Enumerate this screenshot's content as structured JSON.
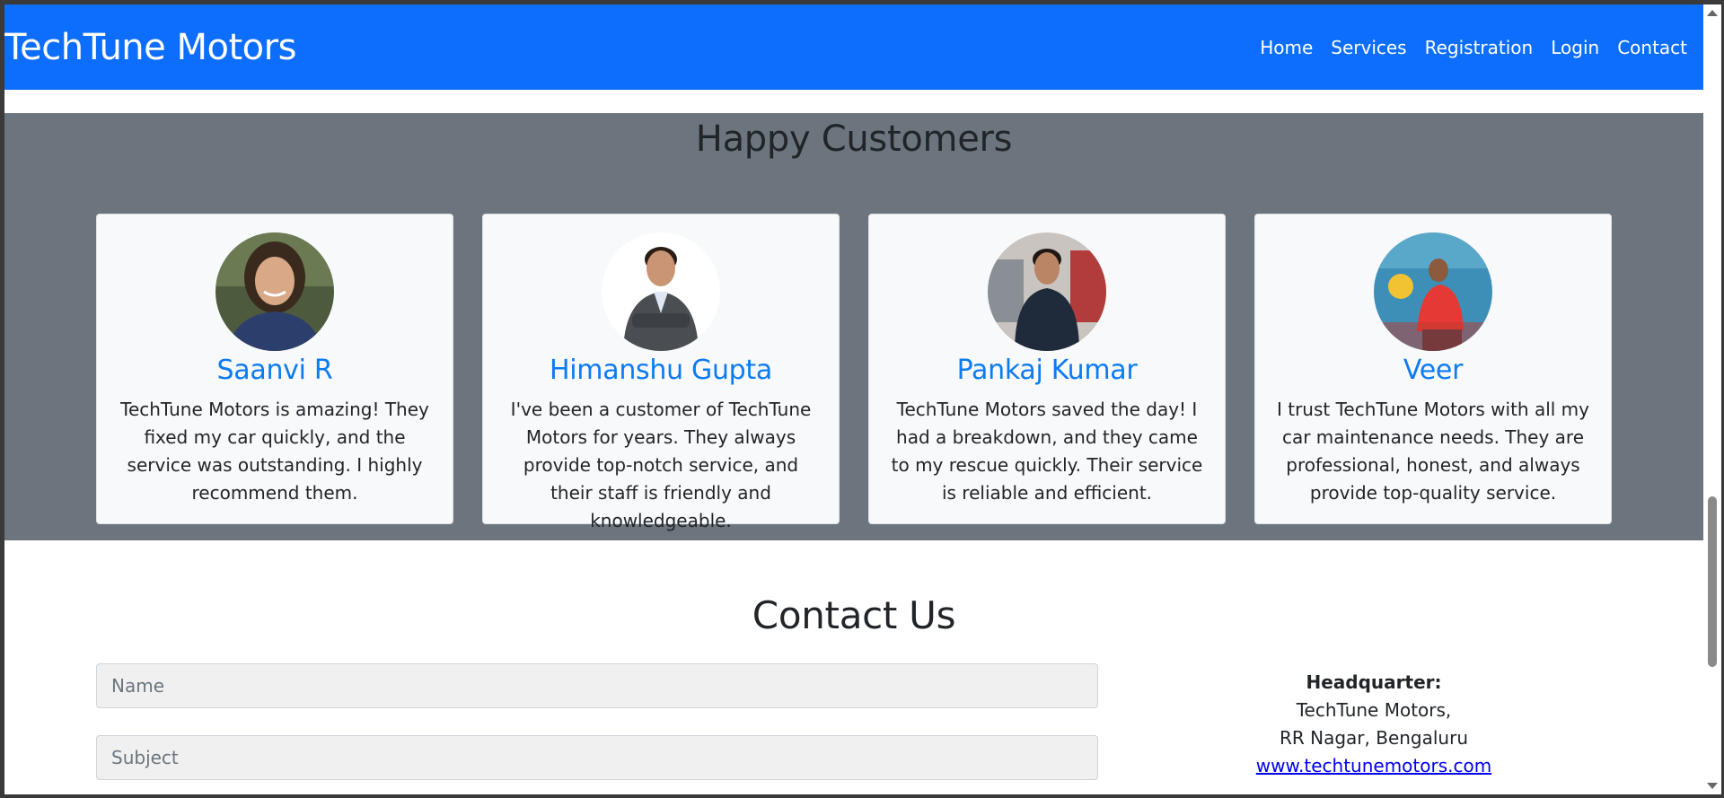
{
  "navbar": {
    "brand": "TechTune Motors",
    "links": [
      "Home",
      "Services",
      "Registration",
      "Login",
      "Contact"
    ]
  },
  "customers": {
    "title": "Happy Customers",
    "items": [
      {
        "name": "Saanvi R",
        "text": "TechTune Motors is amazing! They fixed my car quickly, and the service was outstanding. I highly recommend them."
      },
      {
        "name": "Himanshu Gupta",
        "text": "I've been a customer of TechTune Motors for years. They always provide top-notch service, and their staff is friendly and knowledgeable."
      },
      {
        "name": "Pankaj Kumar",
        "text": "TechTune Motors saved the day! I had a breakdown, and they came to my rescue quickly. Their service is reliable and efficient."
      },
      {
        "name": "Veer",
        "text": "I trust TechTune Motors with all my car maintenance needs. They are professional, honest, and always provide top-quality service."
      }
    ]
  },
  "contact": {
    "title": "Contact Us",
    "name_placeholder": "Name",
    "subject_placeholder": "Subject",
    "hq_label": "Headquarter:",
    "hq_line1": "TechTune Motors,",
    "hq_line2": "RR Nagar, Bengaluru",
    "website": "www.techtunemotors.com"
  },
  "colors": {
    "navbar": "#0d6efd",
    "customers_bg": "#6c757d",
    "name_color": "#0d7bf2"
  }
}
